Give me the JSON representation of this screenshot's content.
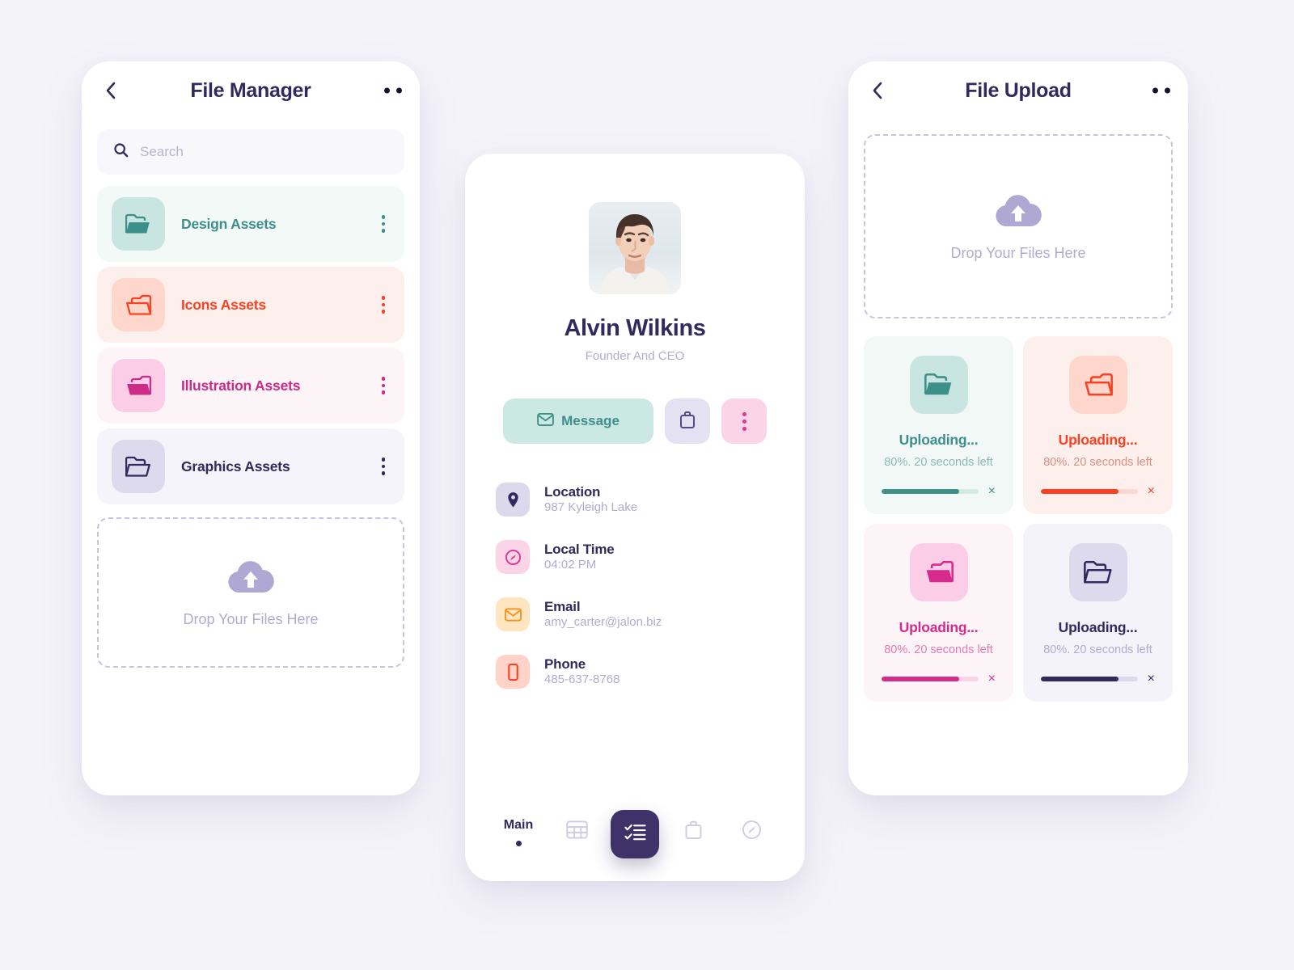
{
  "canvas": {
    "background": "#f4f3f9"
  },
  "file_manager": {
    "title": "File Manager",
    "back_icon": "chevron-left-icon",
    "menu_icon": "more-horizontal-icon",
    "search": {
      "placeholder": "Search",
      "value": "",
      "icon": "search-icon"
    },
    "folders": [
      {
        "label": "Design Assets",
        "icon": "folder-open-icon",
        "accent": "#3d8f8a",
        "icon_bg": "#c9e5e2",
        "row_bg": "#f2f9f7"
      },
      {
        "label": "Icons Assets",
        "icon": "folder-open-flipped-icon",
        "accent": "#fb4122",
        "icon_bg": "#ffd6cb",
        "row_bg": "#fdf0ec"
      },
      {
        "label": "Illustration Assets",
        "icon": "folder-open-flipped-icon",
        "accent": "#cc2b87",
        "icon_bg": "#fbcde6",
        "row_bg": "#fdf4f8"
      },
      {
        "label": "Graphics Assets",
        "icon": "folder-open-icon",
        "accent": "#312a5e",
        "icon_bg": "#dedaee",
        "row_bg": "#f5f4fa"
      }
    ],
    "dropzone": {
      "label": "Drop Your Files Here",
      "icon": "cloud-upload-icon"
    }
  },
  "profile": {
    "avatar_alt": "Alvin Wilkins portrait",
    "name": "Alvin Wilkins",
    "role": "Founder And CEO",
    "actions": {
      "message_label": "Message",
      "message_icon": "envelope-icon",
      "briefcase_icon": "briefcase-icon",
      "more_icon": "more-vertical-icon"
    },
    "details": [
      {
        "title": "Location",
        "value": "987 Kyleigh Lake",
        "icon": "map-pin-icon",
        "icon_color": "#312a5e",
        "icon_bg": "#dcd9ec"
      },
      {
        "title": "Local Time",
        "value": "04:02 PM",
        "icon": "clock-icon",
        "icon_color": "#e5338f",
        "icon_bg": "#fbd4e8"
      },
      {
        "title": "Email",
        "value": "amy_carter@jalon.biz",
        "icon": "envelope-icon",
        "icon_color": "#f79421",
        "icon_bg": "#ffe5c0"
      },
      {
        "title": "Phone",
        "value": "485-637-8768",
        "icon": "mobile-icon",
        "icon_color": "#fb4122",
        "icon_bg": "#ffd3c8"
      }
    ],
    "bottom_nav": {
      "main_label": "Main",
      "items": [
        "grid-table-icon",
        "checklist-icon",
        "briefcase-icon",
        "clock-icon"
      ],
      "active_index": 1
    }
  },
  "file_upload": {
    "title": "File Upload",
    "back_icon": "chevron-left-icon",
    "menu_icon": "more-horizontal-icon",
    "dropzone": {
      "label": "Drop Your Files Here",
      "icon": "cloud-upload-icon"
    },
    "uploads": [
      {
        "title": "Uploading...",
        "status": "80%. 20 seconds left",
        "percent": 80,
        "icon": "folder-open-icon",
        "card_bg": "#f1f8f6",
        "icon_bg": "#c9e5e2",
        "accent": "#3d8f8a",
        "sub_color": "#8db9b3",
        "track": "#d3e9e4",
        "close": "×"
      },
      {
        "title": "Uploading...",
        "status": "80%. 20 seconds left",
        "percent": 80,
        "icon": "folder-open-flipped-icon",
        "card_bg": "#fdefeb",
        "icon_bg": "#ffd6cb",
        "accent": "#fb4122",
        "sub_color": "#d89184",
        "track": "#fcd9d0",
        "close": "×"
      },
      {
        "title": "Uploading...",
        "status": "80%. 20 seconds left",
        "percent": 80,
        "icon": "folder-open-flipped-icon",
        "card_bg": "#fdf4f8",
        "icon_bg": "#fbcde6",
        "accent": "#d62b8c",
        "sub_color": "#e57cb3",
        "track": "#fbd3e7",
        "close": "×"
      },
      {
        "title": "Uploading...",
        "status": "80%. 20 seconds left",
        "percent": 80,
        "icon": "folder-open-icon",
        "card_bg": "#f4f3fa",
        "icon_bg": "#dedaee",
        "accent": "#312a5e",
        "sub_color": "#b0acd0",
        "track": "#dedaee",
        "close": "×"
      }
    ]
  }
}
